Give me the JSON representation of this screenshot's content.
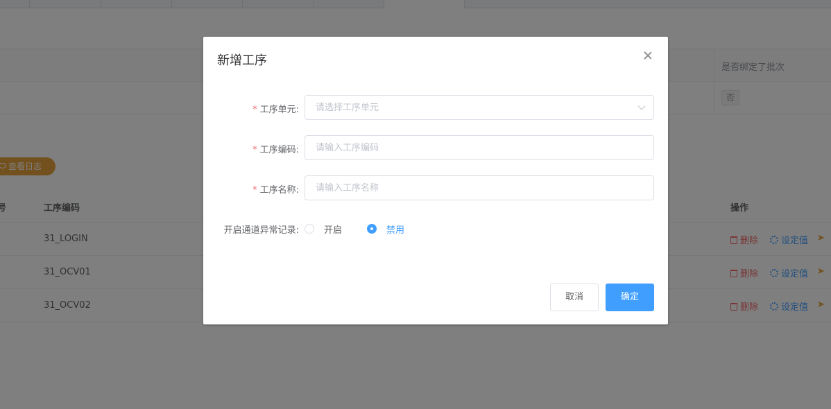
{
  "background": {
    "top_table": {
      "header_last_col": "是否绑定了批次",
      "row1_tag": "否"
    },
    "log_button": "查看日志",
    "main_table": {
      "headers": {
        "no": "号",
        "code": "工序编码",
        "op": "操作"
      },
      "rows": [
        {
          "code": "31_LOGIN"
        },
        {
          "code": "31_OCV01"
        },
        {
          "code": "31_OCV02"
        }
      ],
      "actions": {
        "delete": "删除",
        "set_value": "设定值"
      }
    }
  },
  "dialog": {
    "title": "新增工序",
    "required_mark": "*",
    "fields": {
      "unit": {
        "label": "工序单元:",
        "placeholder": "请选择工序单元",
        "value": ""
      },
      "code": {
        "label": "工序编码:",
        "placeholder": "请输入工序编码",
        "value": ""
      },
      "name": {
        "label": "工序名称:",
        "placeholder": "请输入工序名称",
        "value": ""
      },
      "channel_log": {
        "label": "开启通道异常记录:",
        "options": [
          {
            "label": "开启",
            "checked": false
          },
          {
            "label": "禁用",
            "checked": true
          }
        ]
      }
    },
    "buttons": {
      "cancel": "取消",
      "confirm": "确定"
    }
  },
  "colors": {
    "primary": "#409eff",
    "danger": "#f56c6c",
    "warning": "#e6a23c"
  }
}
